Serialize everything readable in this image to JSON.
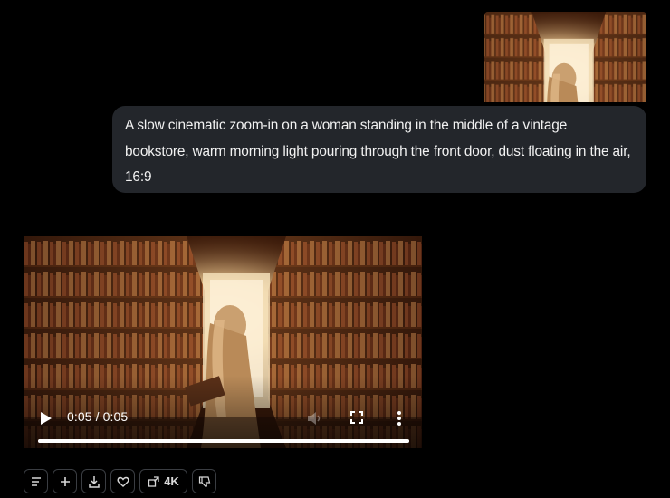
{
  "colors": {
    "page_background": "#000000",
    "bubble_background": "#23262b",
    "text": "#f2f2f2",
    "button_border": "#3a3d42"
  },
  "user_message": {
    "image_icon": "bookstore-thumbnail",
    "prompt_text": "A slow cinematic zoom-in on a woman standing in the middle of a vintage bookstore, warm morning light pouring through the front door, dust floating in the air, 16:9"
  },
  "video_player": {
    "current_time": "0:05",
    "duration": "0:05",
    "time_display": "0:05 / 0:05",
    "progress_fraction": 1.0,
    "icons": [
      "play-icon",
      "volume-icon",
      "fullscreen-icon",
      "more-vertical-icon"
    ]
  },
  "action_bar": {
    "buttons": [
      {
        "icon": "list-icon"
      },
      {
        "icon": "plus-icon"
      },
      {
        "icon": "download-icon"
      },
      {
        "icon": "heart-icon"
      },
      {
        "icon": "upscale-icon",
        "label": "4K"
      },
      {
        "icon": "thumbs-down-icon"
      }
    ]
  }
}
